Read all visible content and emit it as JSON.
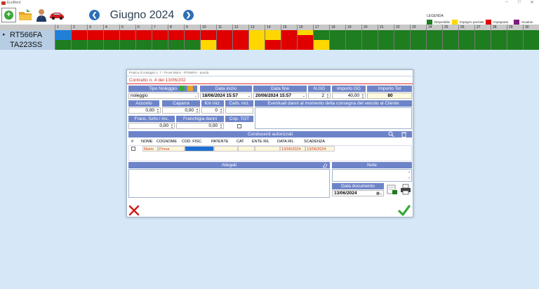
{
  "window": {
    "title": "EcoRent"
  },
  "toolbar": {
    "month": "Giugno 2024",
    "add_icon": "plus-icon",
    "legend_title": "LEGENDA",
    "legend": [
      {
        "label": "Disponibile",
        "color": "#1e7d1e"
      },
      {
        "label": "Impegno parziale",
        "color": "#ffd700"
      },
      {
        "label": "Impegnato",
        "color": "#e00000"
      },
      {
        "label": "Scaduto",
        "color": "#7d1a7d"
      }
    ]
  },
  "calendar": {
    "days": [
      "1",
      "2",
      "3",
      "4",
      "5",
      "6",
      "7",
      "8",
      "9",
      "10",
      "11",
      "12",
      "13",
      "14",
      "15",
      "16",
      "17",
      "18",
      "19",
      "20",
      "21",
      "22",
      "23",
      "24",
      "25",
      "26",
      "27",
      "28",
      "29",
      "30"
    ],
    "vehicles": [
      {
        "plate": "RT566FA",
        "days": [
          [
            "blue",
            "blue"
          ],
          [
            "red",
            "red"
          ],
          [
            "red",
            "red"
          ],
          [
            "red",
            "red"
          ],
          [
            "red",
            "red"
          ],
          [
            "red",
            "red"
          ],
          [
            "red",
            "red"
          ],
          [
            "red",
            "red"
          ],
          [
            "red",
            "red"
          ],
          [
            "red",
            "red"
          ],
          [
            "red",
            "red"
          ],
          [
            "red",
            "red"
          ],
          [
            "yellow",
            "yellow"
          ],
          [
            "yellow",
            "yellow"
          ],
          [
            "red",
            "red"
          ],
          [
            "yellow",
            "red"
          ],
          [
            "green",
            "green"
          ],
          [
            "green",
            "green"
          ],
          [
            "green",
            "green"
          ],
          [
            "green",
            "green"
          ],
          [
            "green",
            "green"
          ],
          [
            "green",
            "green"
          ],
          [
            "green",
            "green"
          ],
          [
            "green",
            "green"
          ],
          [
            "green",
            "green"
          ],
          [
            "green",
            "green"
          ],
          [
            "green",
            "green"
          ],
          [
            "green",
            "green"
          ],
          [
            "green",
            "green"
          ],
          [
            "green",
            "green"
          ]
        ]
      },
      {
        "plate": "TA223SS",
        "days": [
          [
            "green",
            "green"
          ],
          [
            "green",
            "green"
          ],
          [
            "green",
            "green"
          ],
          [
            "green",
            "green"
          ],
          [
            "green",
            "green"
          ],
          [
            "green",
            "green"
          ],
          [
            "green",
            "green"
          ],
          [
            "green",
            "green"
          ],
          [
            "green",
            "green"
          ],
          [
            "yellow",
            "yellow"
          ],
          [
            "red",
            "red"
          ],
          [
            "red",
            "red"
          ],
          [
            "yellow",
            "yellow"
          ],
          [
            "red",
            "red"
          ],
          [
            "red",
            "red"
          ],
          [
            "red",
            "red"
          ],
          [
            "yellow",
            "yellow"
          ],
          [
            "green",
            "green"
          ],
          [
            "green",
            "green"
          ],
          [
            "green",
            "green"
          ],
          [
            "green",
            "green"
          ],
          [
            "green",
            "green"
          ],
          [
            "green",
            "green"
          ],
          [
            "green",
            "green"
          ],
          [
            "green",
            "green"
          ],
          [
            "green",
            "green"
          ],
          [
            "green",
            "green"
          ],
          [
            "green",
            "green"
          ],
          [
            "green",
            "green"
          ],
          [
            "green",
            "green"
          ]
        ]
      }
    ],
    "colors": {
      "blue": "#1f7fd9",
      "red": "#e00000",
      "yellow": "#ffd700",
      "green": "#1e7d1e"
    }
  },
  "dialog": {
    "title": "Pratica di noleggio n. 7 - Prova Mario - RT566FA - panda",
    "contract": "Contratto n. 4 del 13/06/202",
    "labels": {
      "tipo_noleggio": "Tipo Noleggio",
      "data_inizio": "Data inizio",
      "data_fine": "Data fine",
      "n_gg": "N.GG",
      "importo_gg": "Importo GG",
      "importo_tot": "Importo Tot",
      "acconto": "Acconto",
      "caparra": "Caparra",
      "km_iniz": "Km iniz.",
      "carb_iniz": "Carb. iniz.",
      "danni": "Eventuali danni al momento della consegna del veicolo al Cliente",
      "franc": "Franc. furto / inc.",
      "franchigia": "Franchigia danni",
      "cop_tot": "Cop. TOT",
      "conducenti": "Conducenti autorizzati",
      "allegati": "Allegati",
      "note": "Note",
      "data_documento": "Data documento"
    },
    "values": {
      "tipo_noleggio": "noleggio",
      "data_inizio": "18/06/2024 15:57",
      "data_fine": "20/06/2024 15:57",
      "n_gg": "2",
      "importo_gg": "40,00",
      "importo_tot": "80",
      "acconto": "0,00",
      "caparra": "0,00",
      "km_iniz": "0",
      "franc": "0,00",
      "franchigia": "0,00",
      "data_documento": "13/06/2024"
    },
    "driver_columns": [
      "#",
      "NOME",
      "COGNOME",
      "COD. FISC.",
      "PATENTE",
      "CAT",
      "ENTE RIL",
      "DATA RIL",
      "SCADENZA"
    ],
    "drivers": [
      {
        "nome": "Mario",
        "cognome": "Prova",
        "data_ril": "13/06/2024",
        "scadenza": "13/06/2024"
      }
    ]
  }
}
